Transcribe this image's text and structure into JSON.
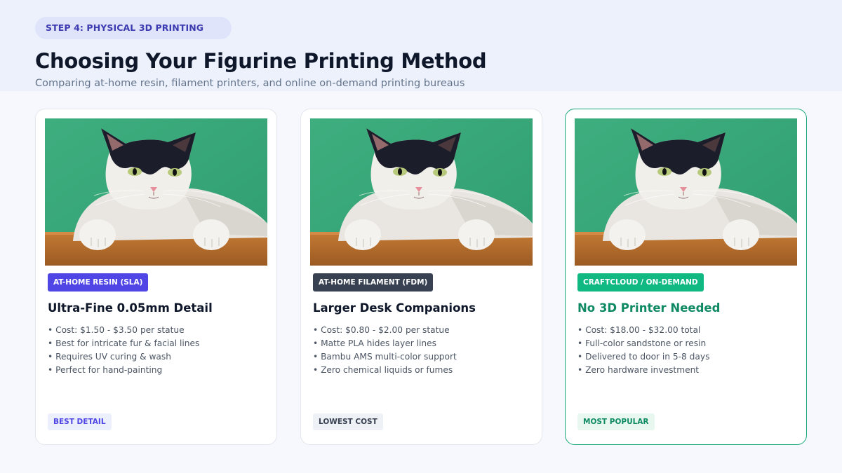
{
  "header": {
    "step_label": "STEP 4: PHYSICAL 3D PRINTING",
    "title": "Choosing Your Figurine Printing Method",
    "subtitle": "Comparing at-home resin, filament printers, and online on-demand printing bureaus"
  },
  "colors": {
    "resin_accent": "#4f46e5",
    "filament_accent": "#374151",
    "craftcloud_accent": "#10b981",
    "craftcloud_heading": "#0f8a63"
  },
  "cards": [
    {
      "tag": "AT-HOME RESIN (SLA)",
      "heading": "Ultra-Fine 0.05mm Detail",
      "features": [
        "• Cost: $1.50 - $3.50 per statue",
        "• Best for intricate fur & facial lines",
        "• Requires UV curing & wash",
        "• Perfect for hand-painting"
      ],
      "badge": "BEST DETAIL"
    },
    {
      "tag": "AT-HOME FILAMENT (FDM)",
      "heading": "Larger Desk Companions",
      "features": [
        "• Cost: $0.80 - $2.00 per statue",
        "• Matte PLA hides layer lines",
        "• Bambu AMS multi-color support",
        "• Zero chemical liquids or fumes"
      ],
      "badge": "LOWEST COST"
    },
    {
      "tag": "CRAFTCLOUD / ON-DEMAND",
      "heading": "No 3D Printer Needed",
      "features": [
        "• Cost: $18.00 - $32.00 total",
        "• Full-color sandstone or resin",
        "• Delivered to door in 5-8 days",
        "• Zero hardware investment"
      ],
      "badge": "MOST POPULAR"
    }
  ]
}
